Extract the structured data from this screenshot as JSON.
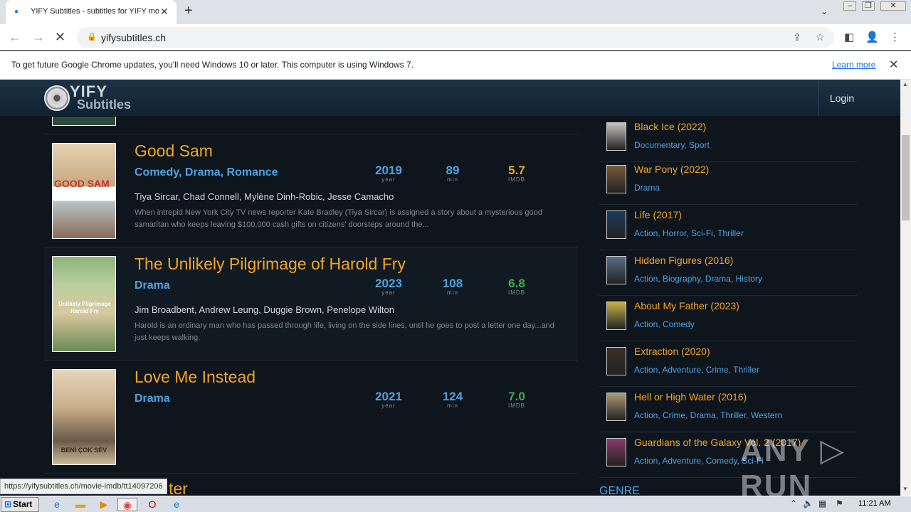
{
  "browser": {
    "tab_title": "YIFY Subtitles - subtitles for YIFY mo",
    "url": "yifysubtitles.ch",
    "infobar_text": "To get future Google Chrome updates, you'll need Windows 10 or later. This computer is using Windows 7.",
    "infobar_link": "Learn more",
    "status_url": "https://yifysubtitles.ch/movie-imdb/tt14097206"
  },
  "site": {
    "logo_top": "YIFY",
    "logo_bottom": "Subtitles",
    "login": "Login"
  },
  "movies": [
    {
      "title": "Good Sam",
      "genres": "Comedy, Drama, Romance",
      "year": "2019",
      "runtime": "89",
      "imdb": "5.7",
      "imdb_color": "#f5a623",
      "cast": "Tiya Sircar, Chad Connell, Mylène Dinh-Robic, Jesse Camacho",
      "description": "When intrepid New York City TV news reporter Kate Bradley (Tiya Sircar) is assigned a story about a mysterious good samaritan who keeps leaving $100,000 cash gifts on citizens' doorsteps around the...",
      "poster_colors": [
        "#d5b89a",
        "#c23a2f"
      ]
    },
    {
      "title": "The Unlikely Pilgrimage of Harold Fry",
      "genres": "Drama",
      "year": "2023",
      "runtime": "108",
      "imdb": "6.8",
      "imdb_color": "#3fae49",
      "cast": "Jim Broadbent, Andrew Leung, Duggie Brown, Penelope Wilton",
      "description": "Harold is an ordinary man who has passed through life, living on the side lines, until he goes to post a letter one day...and just keeps walking.",
      "poster_colors": [
        "#8fb47a",
        "#d8d0b0"
      ]
    },
    {
      "title": "Love Me Instead",
      "genres": "Drama",
      "year": "2021",
      "runtime": "124",
      "imdb": "7.0",
      "imdb_color": "#3fae49",
      "cast": "",
      "description": "",
      "poster_colors": [
        "#e0cfb4",
        "#6a5a48"
      ]
    }
  ],
  "stat_labels": {
    "year": "year",
    "runtime": "min",
    "imdb": "IMDB"
  },
  "poster_texts": {
    "good_sam": "GOOD SAM",
    "harold": "Unlikely Pilgrimage Harold Fry",
    "love": "BENİ ÇOK SEV"
  },
  "partial_next_title": "ter",
  "sidebar": [
    {
      "title": "Black Ice (2022)",
      "genres": "Documentary, Sport",
      "thumb": "#c9c4bc"
    },
    {
      "title": "War Pony (2022)",
      "genres": "Drama",
      "thumb": "#7a5a3a"
    },
    {
      "title": "Life (2017)",
      "genres": "Action, Horror, Sci-Fi, Thriller",
      "thumb": "#1d3a5c"
    },
    {
      "title": "Hidden Figures (2016)",
      "genres": "Action, Biography, Drama, History",
      "thumb": "#5a6d88"
    },
    {
      "title": "About My Father (2023)",
      "genres": "Action, Comedy",
      "thumb": "#c8b04a"
    },
    {
      "title": "Extraction (2020)",
      "genres": "Action, Adventure, Crime, Thriller",
      "thumb": "#3a3028"
    },
    {
      "title": "Hell or High Water (2016)",
      "genres": "Action, Crime, Drama, Thriller, Western",
      "thumb": "#b09a70"
    },
    {
      "title": "Guardians of the Galaxy Vol. 2 (2017)",
      "genres": "Action, Adventure, Comedy, Sci-Fi",
      "thumb": "#8a3a6a"
    }
  ],
  "genre_heading": "GENRE",
  "watermark": "ANY ▷ RUN",
  "taskbar": {
    "start": "Start",
    "clock": "11:21 AM"
  }
}
